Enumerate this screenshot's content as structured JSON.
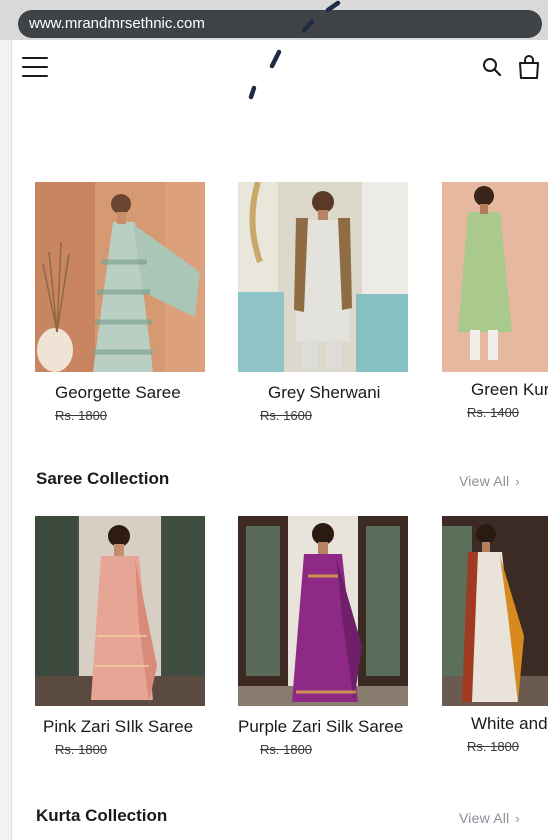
{
  "browser": {
    "url": "www.mrandmrsethnic.com"
  },
  "header": {
    "menu_icon": "hamburger-menu-icon",
    "search_icon": "search-icon",
    "bag_icon": "shopping-bag-icon"
  },
  "featured": {
    "products": [
      {
        "name": "Georgette Saree",
        "price": "Rs. 1800"
      },
      {
        "name": "Grey Sherwani",
        "price": "Rs. 1600"
      },
      {
        "name": "Green Kur",
        "price": "Rs. 1400"
      }
    ]
  },
  "saree_collection": {
    "title": "Saree Collection",
    "view_all": "View All",
    "products": [
      {
        "name": "Pink Zari SIlk Saree",
        "price": "Rs. 1800"
      },
      {
        "name": "Purple Zari Silk Saree",
        "price": "Rs. 1800"
      },
      {
        "name": "White and",
        "price": "Rs. 1800"
      }
    ]
  },
  "kurta_collection": {
    "title": "Kurta Collection",
    "view_all": "View All"
  },
  "colors": {
    "url_bar": "#3f4246",
    "link_gray": "#8a8f98",
    "text": "#1a1a1a"
  }
}
